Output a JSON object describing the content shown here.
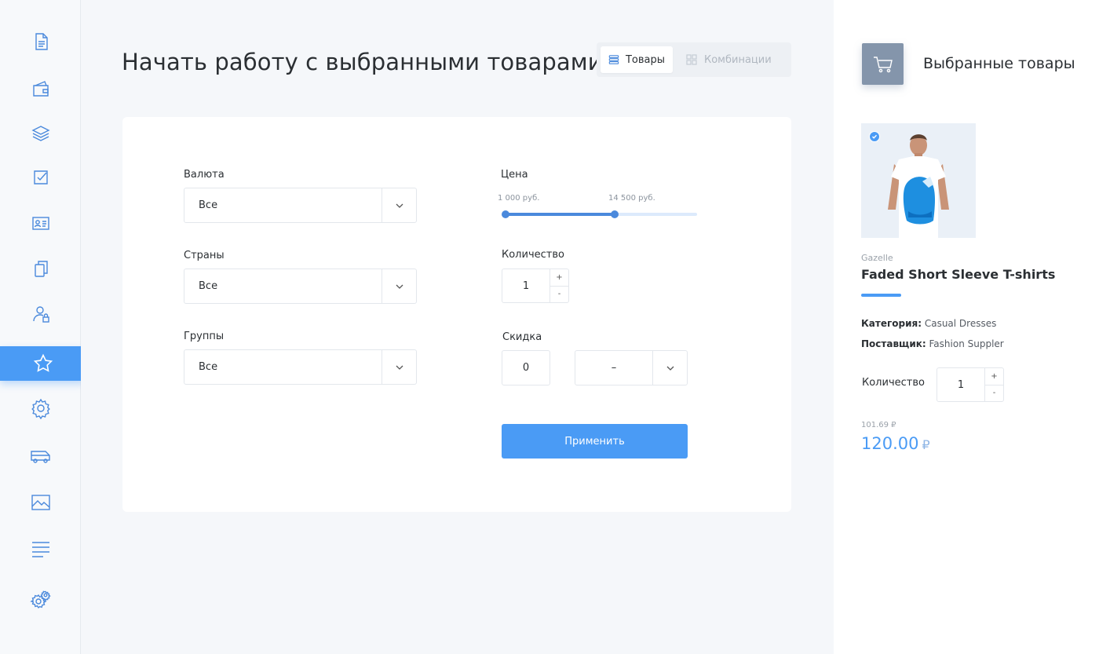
{
  "sidebar": {
    "items": [
      {
        "icon": "document-icon"
      },
      {
        "icon": "wallet-icon"
      },
      {
        "icon": "layers-icon"
      },
      {
        "icon": "checkbox-icon"
      },
      {
        "icon": "contact-card-icon"
      },
      {
        "icon": "copy-icon"
      },
      {
        "icon": "user-lock-icon"
      },
      {
        "icon": "star-icon",
        "active": true
      },
      {
        "icon": "gear-icon"
      },
      {
        "icon": "truck-icon"
      },
      {
        "icon": "image-icon"
      },
      {
        "icon": "menu-lines-icon"
      },
      {
        "icon": "gears-icon"
      }
    ],
    "active_color": "#4a9bf5",
    "icon_color": "#4a89dc"
  },
  "header": {
    "title": "Начать работу с выбранными товарами",
    "tabs": [
      {
        "label": "Товары",
        "active": true
      },
      {
        "label": "Комбинации",
        "active": false
      }
    ]
  },
  "filters": {
    "currency": {
      "label": "Валюта",
      "value": "Все"
    },
    "countries": {
      "label": "Страны",
      "value": "Все"
    },
    "groups": {
      "label": "Группы",
      "value": "Все"
    },
    "price": {
      "label": "Цена",
      "min_label": "1 000 руб.",
      "max_label": "14 500 руб.",
      "range_fraction": [
        0,
        0.57
      ]
    },
    "quantity": {
      "label": "Количество",
      "value": "1",
      "plus": "+",
      "minus": "-"
    },
    "discount": {
      "label": "Скидка",
      "value": "0",
      "type_value": "–"
    },
    "apply_label": "Применить"
  },
  "selected": {
    "title": "Выбранные товары",
    "brand": "Gazelle",
    "product_name": "Faded Short Sleeve T-shirts",
    "category_label": "Категория:",
    "category_value": "Casual Dresses",
    "supplier_label": "Поставщик:",
    "supplier_value": "Fashion Suppler",
    "quantity_label": "Количество",
    "quantity_value": "1",
    "plus": "+",
    "minus": "-",
    "old_price": "101.69 ₽",
    "price": "120.00",
    "currency": "₽"
  }
}
